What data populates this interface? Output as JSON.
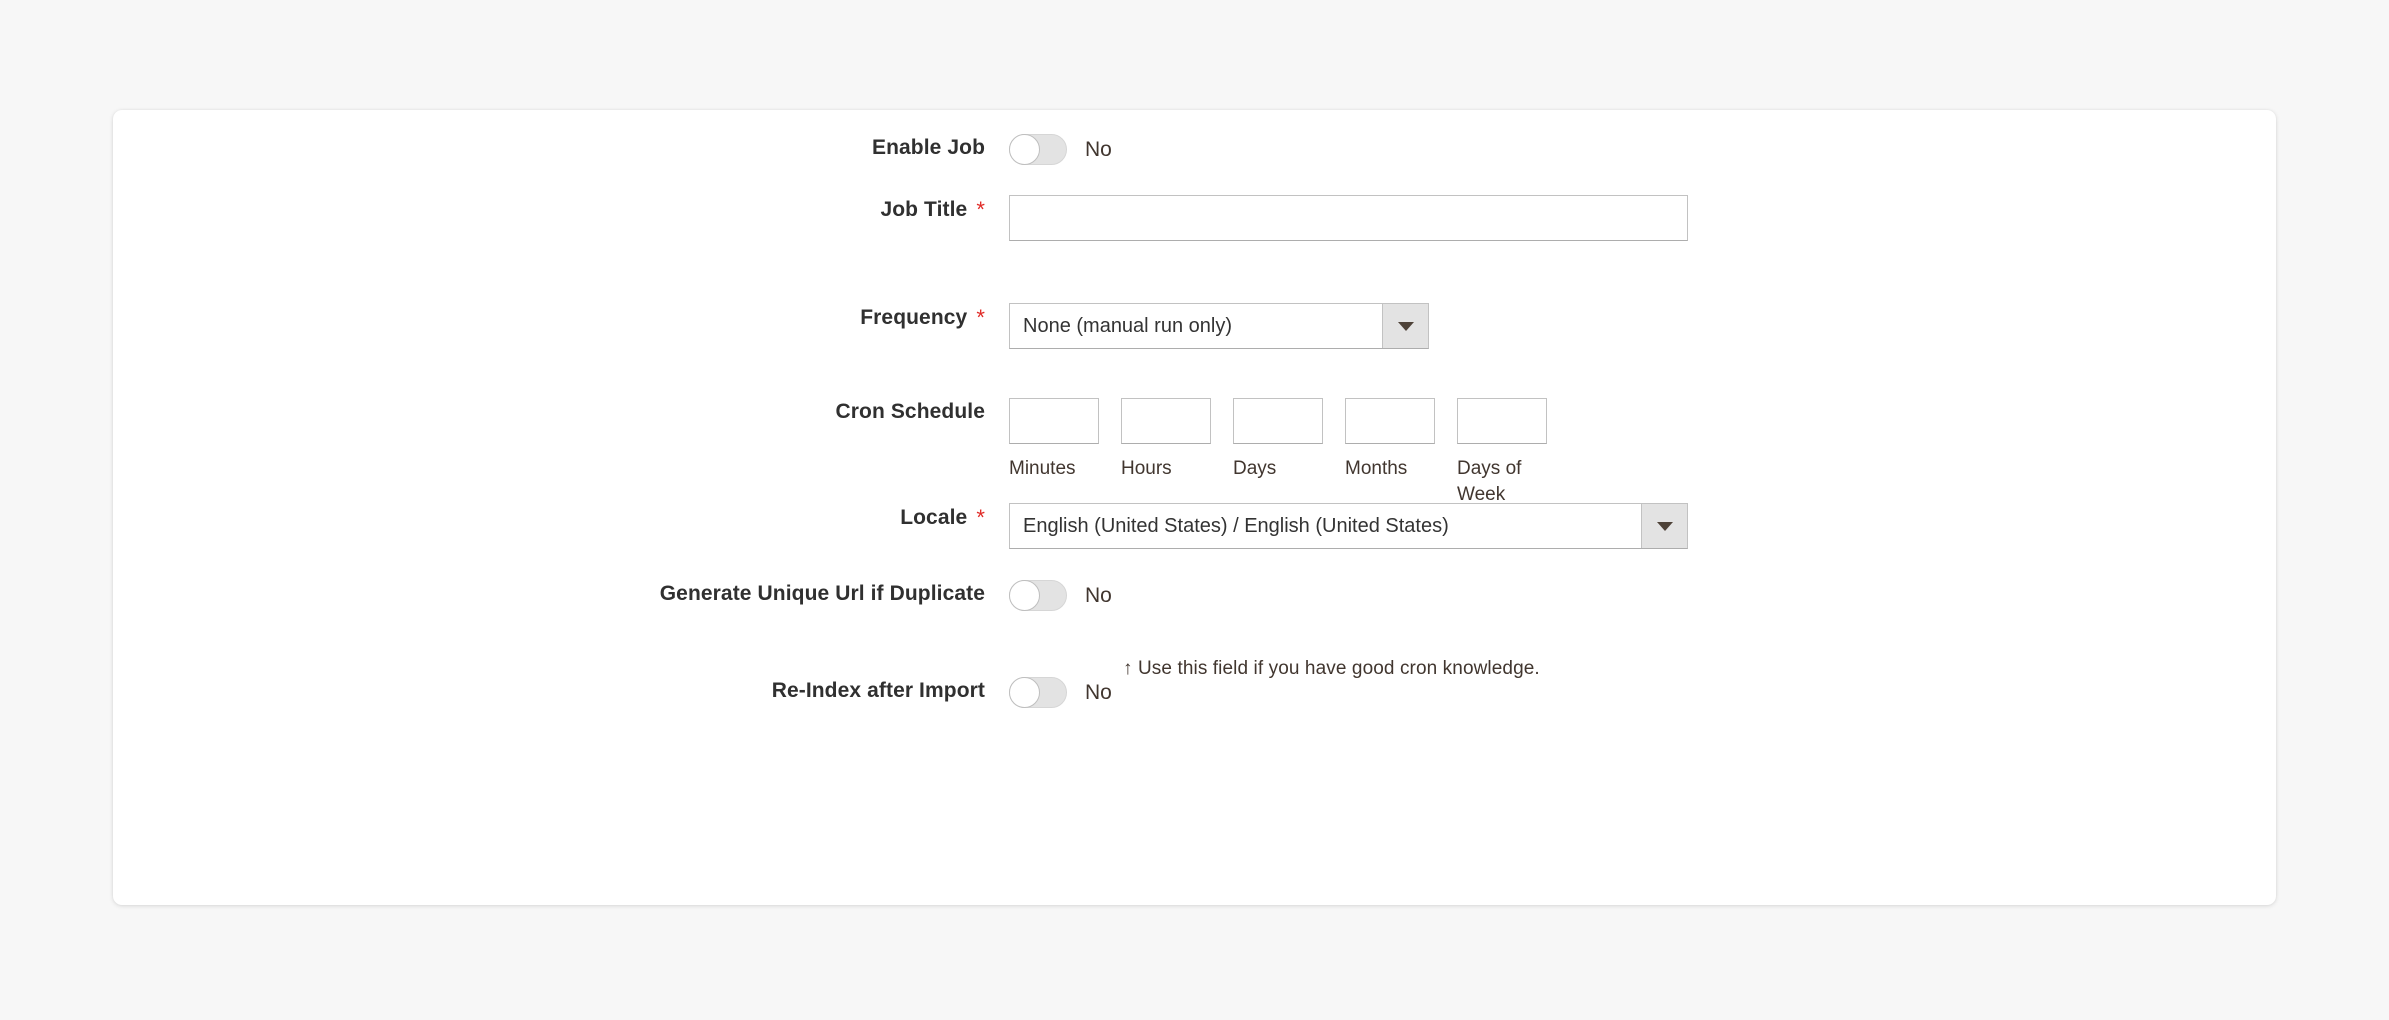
{
  "theme": {
    "page_background": "#f7f7f7",
    "panel_background": "#ffffff",
    "required_asterisk_color": "#e02b27",
    "toggle_track_color": "#e3e3e3",
    "toggle_knob_color": "#ffffff",
    "select_arrow_button_color": "#e3e3e3",
    "text_color": "#41362f",
    "label_color": "#303030",
    "input_border_color": "#c2c2c2"
  },
  "form": {
    "enable_job": {
      "label": "Enable Job",
      "required": false,
      "toggle_state": "off",
      "toggle_value_text": "No"
    },
    "job_title": {
      "label": "Job Title",
      "required": true,
      "required_marker": "*",
      "value": "",
      "placeholder": ""
    },
    "frequency": {
      "label": "Frequency",
      "required": true,
      "required_marker": "*",
      "selected": "None (manual run only)",
      "arrow_icon": "chevron-down-icon"
    },
    "cron_schedule": {
      "label": "Cron Schedule",
      "required": false,
      "fields": [
        {
          "name": "minutes",
          "caption": "Minutes",
          "value": ""
        },
        {
          "name": "hours",
          "caption": "Hours",
          "value": ""
        },
        {
          "name": "days",
          "caption": "Days",
          "value": ""
        },
        {
          "name": "months",
          "caption": "Months",
          "value": ""
        },
        {
          "name": "days_of_week",
          "caption": "Days of Week",
          "value": ""
        }
      ],
      "hint": "↑ Use this field if you have good cron knowledge."
    },
    "locale": {
      "label": "Locale",
      "required": true,
      "required_marker": "*",
      "selected": "English (United States) / English (United States)",
      "arrow_icon": "chevron-down-icon"
    },
    "generate_unique_url": {
      "label": "Generate Unique Url if Duplicate",
      "required": false,
      "toggle_state": "off",
      "toggle_value_text": "No"
    },
    "reindex_after_import": {
      "label": "Re-Index after Import",
      "required": false,
      "toggle_state": "off",
      "toggle_value_text": "No"
    }
  }
}
